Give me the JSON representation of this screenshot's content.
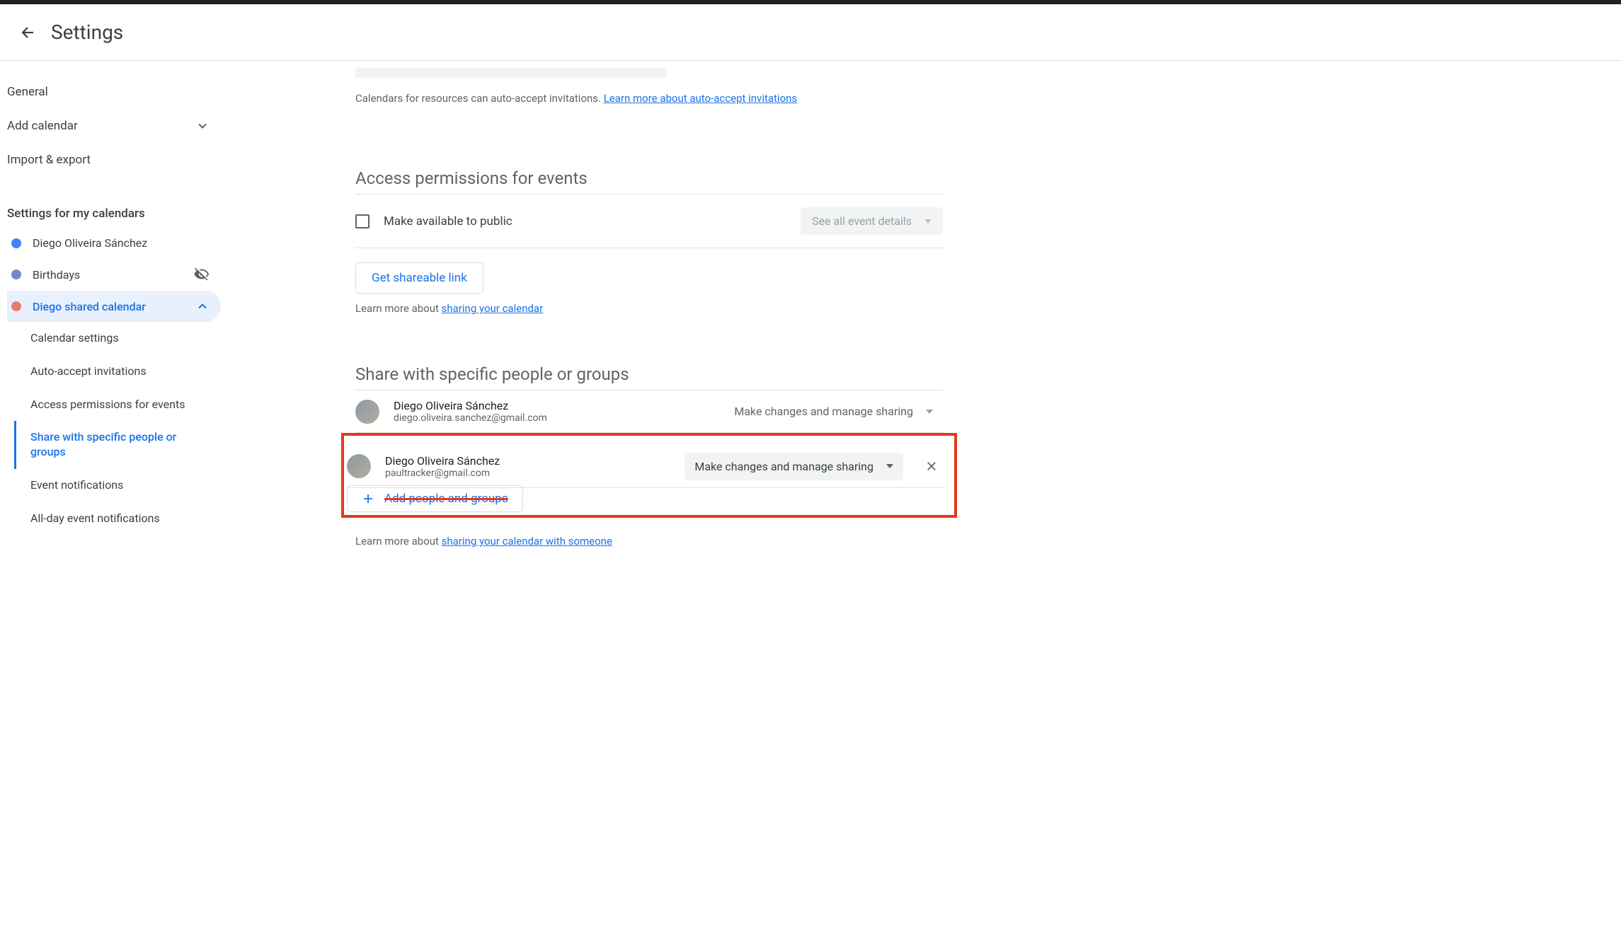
{
  "header": {
    "title": "Settings"
  },
  "sidebar": {
    "general_label": "General",
    "add_calendar_label": "Add calendar",
    "import_export_label": "Import & export",
    "section_title": "Settings for my calendars",
    "calendars": [
      {
        "label": "Diego Oliveira Sánchez",
        "color": "blue",
        "hidden": false,
        "expanded": false
      },
      {
        "label": "Birthdays",
        "color": "purple",
        "hidden": true,
        "expanded": false
      },
      {
        "label": "Diego shared calendar",
        "color": "coral",
        "hidden": false,
        "expanded": true
      }
    ],
    "sub_items": [
      {
        "label": "Calendar settings",
        "active": false
      },
      {
        "label": "Auto-accept invitations",
        "active": false
      },
      {
        "label": "Access permissions for events",
        "active": false
      },
      {
        "label": "Share with specific people or groups",
        "active": true
      },
      {
        "label": "Event notifications",
        "active": false
      },
      {
        "label": "All-day event notifications",
        "active": false
      }
    ]
  },
  "content": {
    "auto_accept_caption": "Calendars for resources can auto-accept invitations. ",
    "auto_accept_link": "Learn more about auto-accept invitations",
    "access_section_title": "Access permissions for events",
    "public_checkbox_label": "Make available to public",
    "public_select_label": "See all event details",
    "shareable_btn": "Get shareable link",
    "learn_prefix": "Learn more about ",
    "sharing_link": "sharing your calendar",
    "share_section_title": "Share with specific people or groups",
    "people": [
      {
        "name": "Diego Oliveira Sánchez",
        "email": "diego.oliveira.sanchez@gmail.com",
        "permission": "Make changes and manage sharing",
        "removable": false,
        "select_plain": true
      },
      {
        "name": "Diego Oliveira Sánchez",
        "email": "paultracker@gmail.com",
        "permission": "Make changes and manage sharing",
        "removable": true,
        "select_plain": false
      }
    ],
    "add_people_btn": "Add people and groups",
    "sharing_someone_link": "sharing your calendar with someone"
  }
}
